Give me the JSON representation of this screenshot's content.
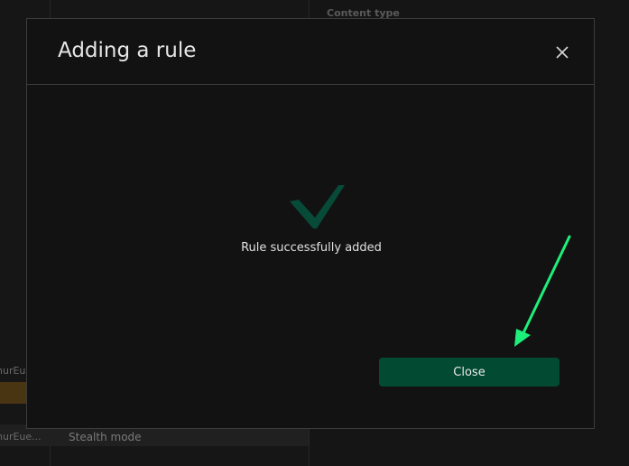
{
  "background": {
    "content_type_label": "Content type",
    "row1_label": "hurEue",
    "row2_label": "hurEue...",
    "stealth_label": "Stealth mode"
  },
  "dialog": {
    "title": "Adding a rule",
    "close_icon": "close-x-icon",
    "success_icon": "checkmark-icon",
    "message": "Rule successfully added",
    "close_button_label": "Close"
  },
  "annotation": {
    "arrow_icon": "arrow-pointer-icon",
    "arrow_color": "#1df07a"
  },
  "colors": {
    "accent": "#024a32",
    "check": "#064a37",
    "dialog_bg": "#121212",
    "highlight": "#4a3512"
  }
}
